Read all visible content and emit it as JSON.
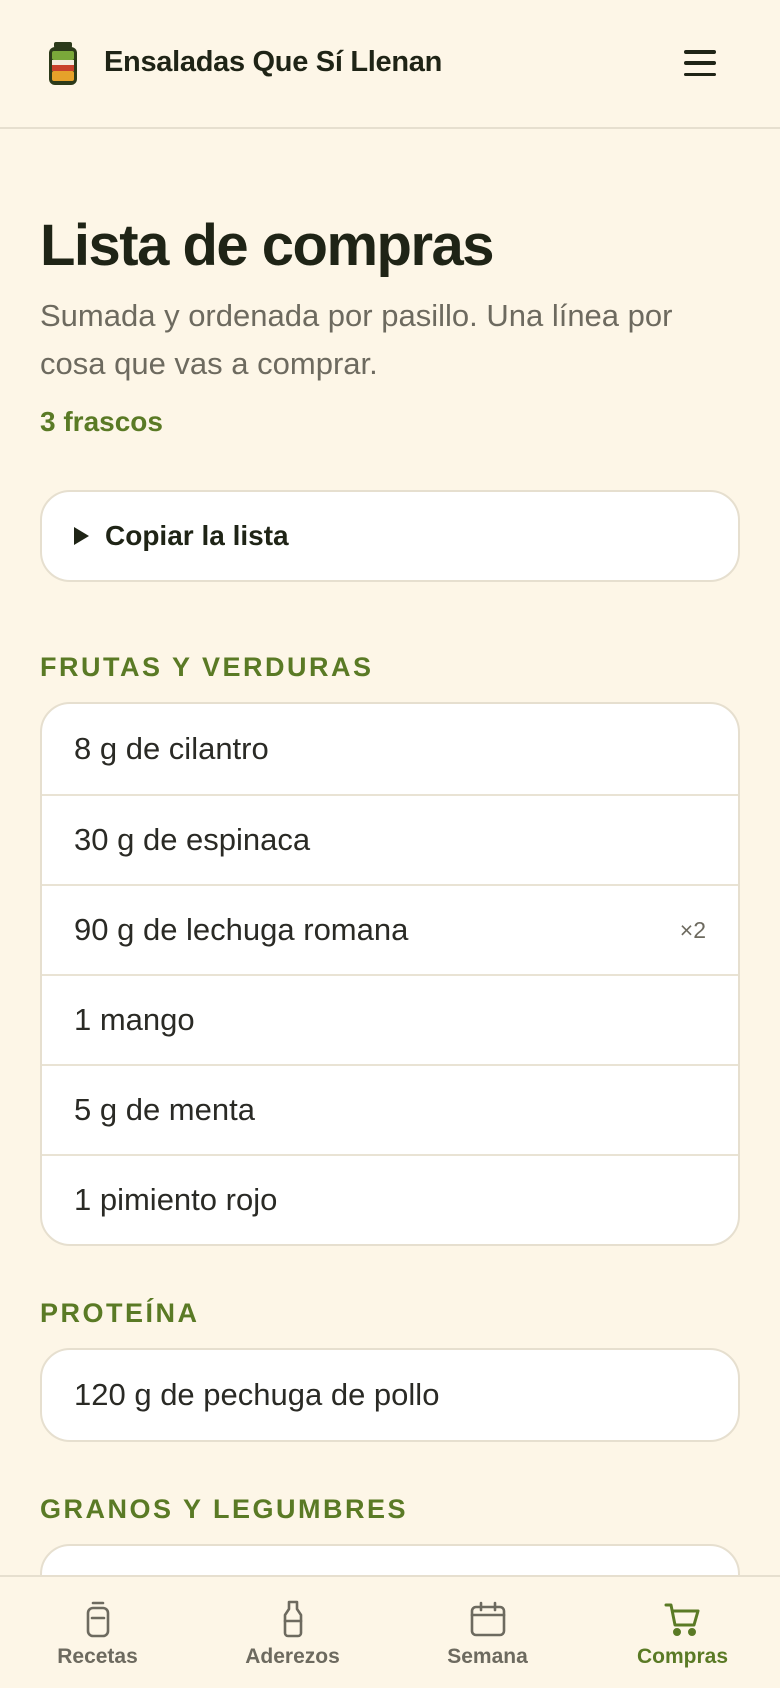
{
  "app": {
    "title": "Ensaladas Que Sí Llenan"
  },
  "page": {
    "title": "Lista de compras",
    "subtitle": "Sumada y ordenada por pasillo. Una línea por cosa que vas a comprar.",
    "jar_count": "3 frascos",
    "copy_label": "Copiar la lista"
  },
  "sections": [
    {
      "title": "FRUTAS Y VERDURAS",
      "items": [
        {
          "text": "8 g de cilantro",
          "mult": ""
        },
        {
          "text": "30 g de espinaca",
          "mult": ""
        },
        {
          "text": "90 g de lechuga romana",
          "mult": "×2"
        },
        {
          "text": "1 mango",
          "mult": ""
        },
        {
          "text": "5 g de menta",
          "mult": ""
        },
        {
          "text": "1 pimiento rojo",
          "mult": ""
        }
      ]
    },
    {
      "title": "PROTEÍNA",
      "items": [
        {
          "text": "120 g de pechuga de pollo",
          "mult": ""
        }
      ]
    },
    {
      "title": "GRANOS Y LEGUMBRES",
      "items": []
    }
  ],
  "nav": [
    {
      "label": "Recetas",
      "icon": "jar-icon",
      "active": false
    },
    {
      "label": "Aderezos",
      "icon": "bottle-icon",
      "active": false
    },
    {
      "label": "Semana",
      "icon": "calendar-icon",
      "active": false
    },
    {
      "label": "Compras",
      "icon": "cart-icon",
      "active": true
    }
  ],
  "colors": {
    "background": "#fdf6e7",
    "accent": "#5a7a25",
    "text": "#1f2416",
    "muted": "#6d6a5f",
    "border": "#e6dfcf"
  }
}
